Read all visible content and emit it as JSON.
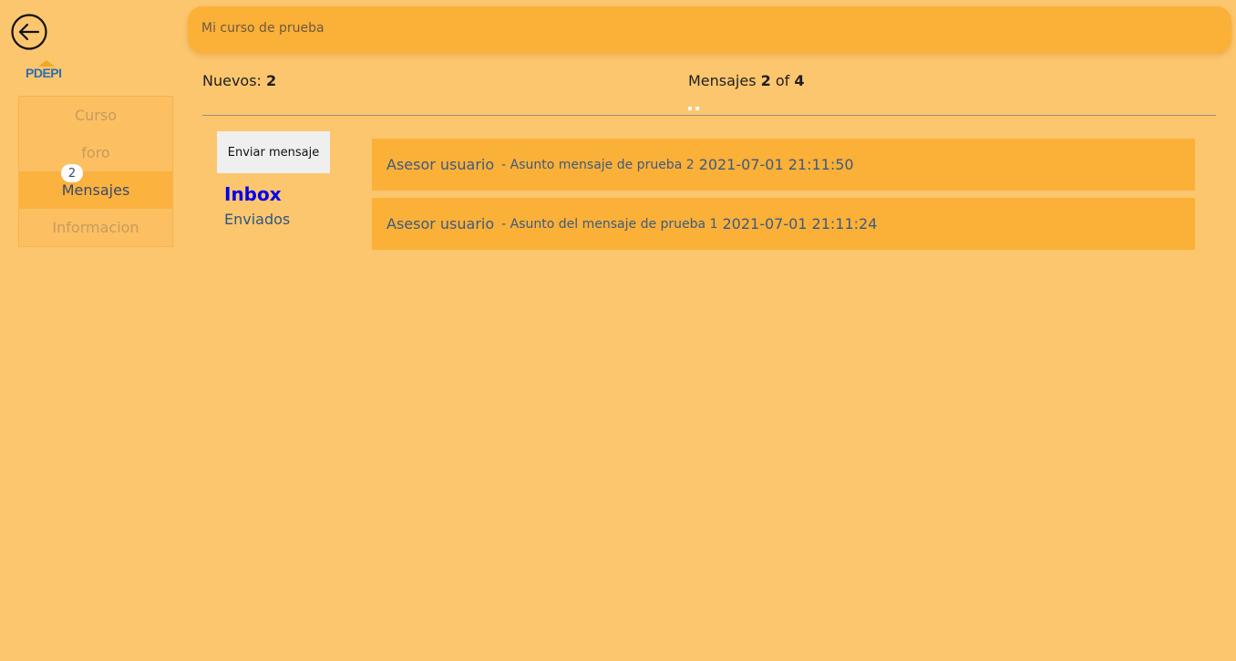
{
  "header": {
    "course_title": "Mi curso de prueba"
  },
  "logo": {
    "text": "PDEPI"
  },
  "sidebar": {
    "items": [
      {
        "label": "Curso",
        "active": false
      },
      {
        "label": "foro",
        "active": false
      },
      {
        "label": "Mensajes",
        "active": true,
        "badge": "2"
      },
      {
        "label": "Informacion",
        "active": false
      }
    ]
  },
  "stats": {
    "new_label": "Nuevos:",
    "new_count": "2",
    "messages_label": "Mensajes",
    "messages_current": "2",
    "messages_of": "of",
    "messages_total": "4"
  },
  "actions": {
    "send_label": "Enviar mensaje"
  },
  "folders": {
    "inbox": "Inbox",
    "sent": "Enviados"
  },
  "messages": [
    {
      "sender": "Asesor usuario",
      "subject": "- Asunto mensaje de prueba 2",
      "date": "2021-07-01 21:11:50"
    },
    {
      "sender": "Asesor usuario",
      "subject": "- Asunto del mensaje de prueba 1",
      "date": "2021-07-01 21:11:24"
    }
  ],
  "colors": {
    "background": "#fcc66e",
    "accent": "#fbb037",
    "link_active": "#0000ee",
    "text_blue": "#3d5a80"
  }
}
